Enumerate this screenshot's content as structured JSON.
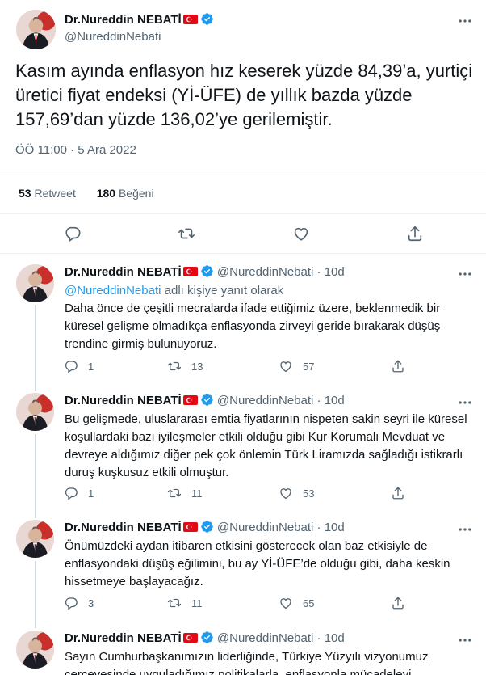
{
  "author": {
    "display_name": "Dr.Nureddin NEBATİ",
    "display_name_short": "Dr.Nureddin NEBATİ",
    "handle": "@NureddinNebati",
    "flag_icon": "turkey-flag-icon",
    "verified_icon": "verified-badge-icon"
  },
  "main_tweet": {
    "text": "Kasım ayında enflasyon hız keserek yüzde 84,39’a, yurtiçi üretici fiyat endeksi (Yİ-ÜFE) de yıllık bazda yüzde 157,69’dan yüzde 136,02’ye gerilemiştir.",
    "timestamp": "ÖÖ 11:00 · 5 Ara 2022",
    "retweets_count": "53",
    "retweets_label": "Retweet",
    "likes_count": "180",
    "likes_label": "Beğeni"
  },
  "replies": [
    {
      "name": "Dr.Nureddin NEBATİ",
      "meta": "@NureddinNebati · 10d",
      "reply_to_handle": "@NureddinNebati",
      "reply_to_suffix": " adlı kişiye yanıt olarak",
      "text": "Daha önce de çeşitli mecralarda ifade ettiğimiz üzere, beklenmedik bir küresel gelişme olmadıkça enflasyonda zirveyi geride bırakarak düşüş trendine girmiş bulunuyoruz.",
      "replies": "1",
      "retweets": "13",
      "likes": "57"
    },
    {
      "name": "Dr.Nureddin NEBATİ",
      "meta": "@NureddinNebati · 10d",
      "text": "Bu gelişmede, uluslararası emtia fiyatlarının nispeten sakin seyri ile küresel koşullardaki bazı iyileşmeler etkili olduğu gibi Kur Korumalı Mevduat ve devreye aldığımız diğer pek çok önlemin Türk Liramızda sağladığı istikrarlı duruş kuşkusuz etkili olmuştur.",
      "replies": "1",
      "retweets": "11",
      "likes": "53"
    },
    {
      "name": "Dr.Nureddin NEBATİ",
      "meta": "@NureddinNebati · 10d",
      "text": "Önümüzdeki aydan itibaren etkisini gösterecek olan baz etkisiyle de enflasyondaki düşüş eğilimini, bu ay Yİ-ÜFE’de olduğu gibi, daha keskin hissetmeye başlayacağız.",
      "replies": "3",
      "retweets": "11",
      "likes": "65"
    },
    {
      "name": "Dr.Nureddin NEBATİ",
      "meta": "@NureddinNebati · 10d",
      "text": "Sayın Cumhurbaşkanımızın liderliğinde, Türkiye Yüzyılı vizyonumuz çerçevesinde uyguladığımız politikalarla, enflasyonla mücadeleyi kararlılıkla",
      "replies": "",
      "retweets": "",
      "likes": ""
    }
  ],
  "icons": {
    "more": "more-options-icon",
    "reply": "reply-icon",
    "retweet": "retweet-icon",
    "like": "like-icon",
    "share": "share-icon"
  },
  "colors": {
    "accent": "#1d9bf0",
    "secondary_text": "#536471",
    "flag_red": "#e30a17"
  }
}
